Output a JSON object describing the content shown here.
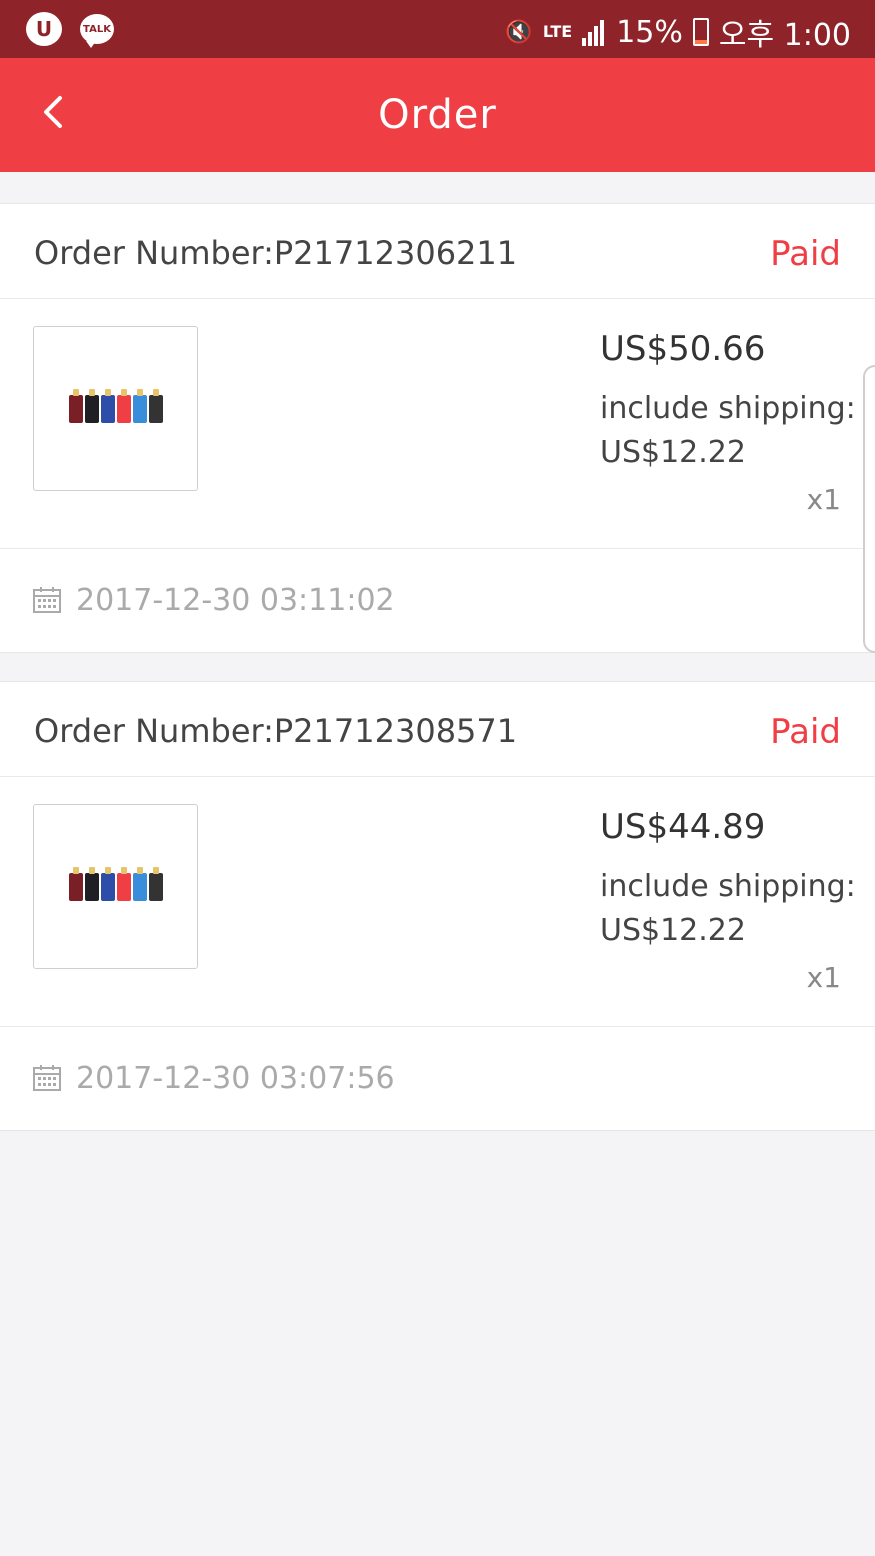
{
  "status_bar": {
    "lte": "LTE",
    "battery_text": "15%",
    "battery_level": 0.15,
    "time": "오후 1:00",
    "talk": "TALK"
  },
  "app_bar": {
    "title": "Order"
  },
  "orders": [
    {
      "number_label": "Order Number:P21712306211",
      "status": "Paid",
      "price": "US$50.66",
      "shipping_label": "include shipping:",
      "shipping_value": "US$12.22",
      "quantity": "x1",
      "date": "2017-12-30 03:11:02"
    },
    {
      "number_label": "Order Number:P21712308571",
      "status": "Paid",
      "price": "US$44.89",
      "shipping_label": "include shipping:",
      "shipping_value": "US$12.22",
      "quantity": "x1",
      "date": "2017-12-30 03:07:56"
    }
  ],
  "colors": {
    "accent": "#ef3f45",
    "status_bar": "#8e2429",
    "background": "#f4f4f6"
  }
}
